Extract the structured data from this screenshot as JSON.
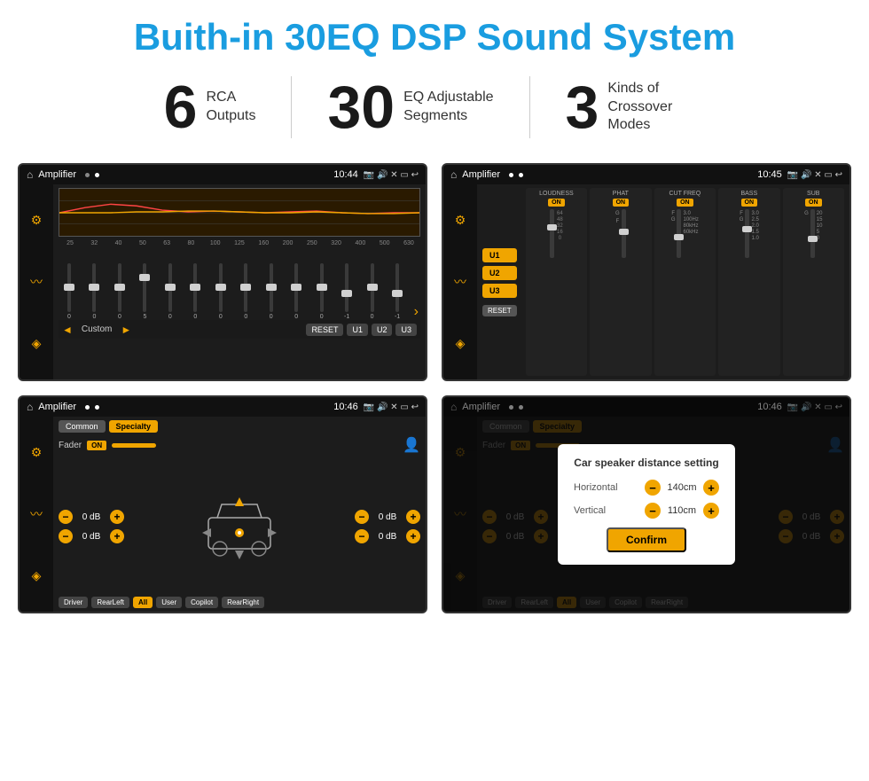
{
  "header": {
    "title": "Buith-in 30EQ DSP Sound System"
  },
  "stats": [
    {
      "number": "6",
      "text_line1": "RCA",
      "text_line2": "Outputs"
    },
    {
      "number": "30",
      "text_line1": "EQ Adjustable",
      "text_line2": "Segments"
    },
    {
      "number": "3",
      "text_line1": "Kinds of",
      "text_line2": "Crossover Modes"
    }
  ],
  "screenshots": {
    "eq": {
      "status_bar": {
        "title": "Amplifier",
        "time": "10:44"
      },
      "frequencies": [
        "25",
        "32",
        "40",
        "50",
        "63",
        "80",
        "100",
        "125",
        "160",
        "200",
        "250",
        "320",
        "400",
        "500",
        "630"
      ],
      "slider_values": [
        "0",
        "0",
        "0",
        "5",
        "0",
        "0",
        "0",
        "0",
        "0",
        "0",
        "0",
        "-1",
        "0",
        "-1"
      ],
      "preset": "Custom",
      "buttons": [
        "RESET",
        "U1",
        "U2",
        "U3"
      ]
    },
    "crossover": {
      "status_bar": {
        "title": "Amplifier",
        "time": "10:45"
      },
      "presets": [
        "U1",
        "U2",
        "U3"
      ],
      "channels": [
        {
          "label": "LOUDNESS",
          "on": true
        },
        {
          "label": "PHAT",
          "on": true
        },
        {
          "label": "CUT FREQ",
          "on": true
        },
        {
          "label": "BASS",
          "on": true
        },
        {
          "label": "SUB",
          "on": true
        }
      ],
      "reset_label": "RESET"
    },
    "fader": {
      "status_bar": {
        "title": "Amplifier",
        "time": "10:46"
      },
      "tabs": [
        "Common",
        "Specialty"
      ],
      "fader_label": "Fader",
      "fader_on": "ON",
      "controls": [
        {
          "label": "0 dB"
        },
        {
          "label": "0 dB"
        },
        {
          "label": "0 dB"
        },
        {
          "label": "0 dB"
        }
      ],
      "buttons": [
        "Driver",
        "RearLeft",
        "All",
        "User",
        "Copilot",
        "RearRight"
      ]
    },
    "dialog": {
      "status_bar": {
        "title": "Amplifier",
        "time": "10:46"
      },
      "tabs": [
        "Common",
        "Specialty"
      ],
      "dialog_title": "Car speaker distance setting",
      "fields": [
        {
          "label": "Horizontal",
          "value": "140cm"
        },
        {
          "label": "Vertical",
          "value": "110cm"
        }
      ],
      "confirm_label": "Confirm",
      "side_controls": [
        {
          "label": "0 dB"
        },
        {
          "label": "0 dB"
        }
      ]
    }
  }
}
